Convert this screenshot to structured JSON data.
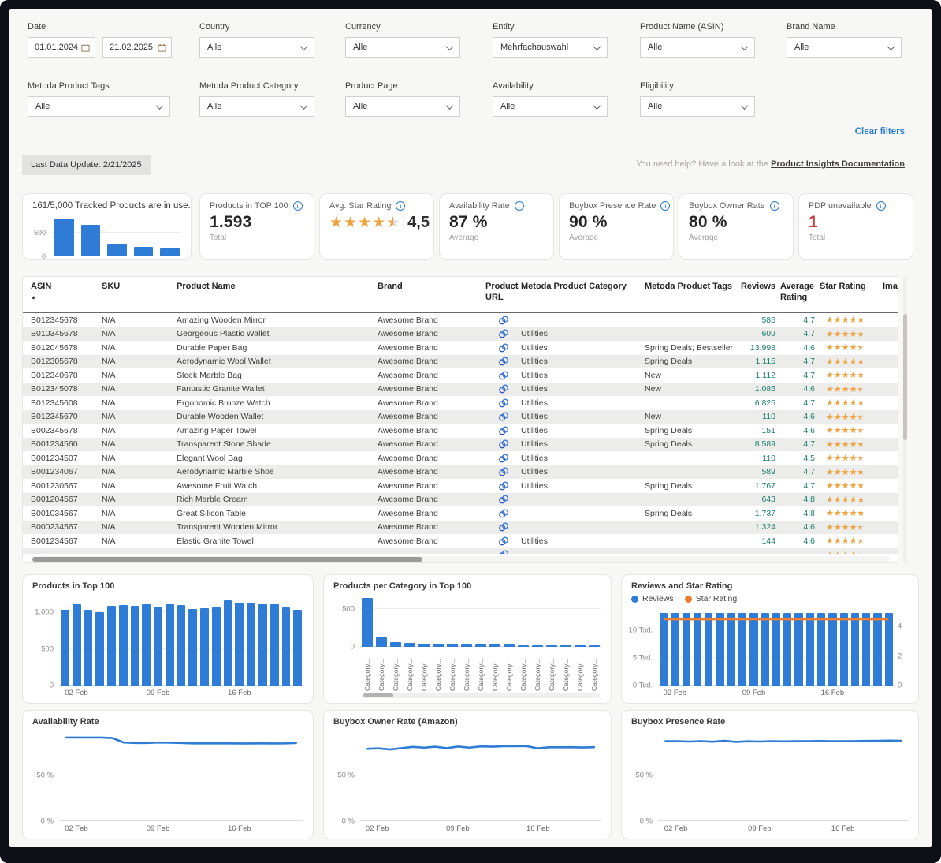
{
  "filters": {
    "date": {
      "label": "Date",
      "from": "01.01.2024",
      "to": "21.02.2025"
    },
    "row1": [
      {
        "label": "Country",
        "value": "Alle"
      },
      {
        "label": "Currency",
        "value": "Alle"
      },
      {
        "label": "Entity",
        "value": "Mehrfachauswahl"
      },
      {
        "label": "Product Name (ASIN)",
        "value": "Alle"
      },
      {
        "label": "Brand Name",
        "value": "Alle"
      }
    ],
    "row2": [
      {
        "label": "Metoda Product Tags",
        "value": "Alle"
      },
      {
        "label": "Metoda Product Category",
        "value": "Alle"
      },
      {
        "label": "Product Page",
        "value": "Alle"
      },
      {
        "label": "Availability",
        "value": "Alle"
      },
      {
        "label": "Eligibility",
        "value": "Alle"
      }
    ],
    "clear": "Clear filters"
  },
  "status": {
    "last_update": "Last Data Update: 2/21/2025",
    "help_text": "You need help? Have a look at the",
    "help_link": "Product Insights Documentation"
  },
  "kpis": {
    "top100": {
      "title": "Products in TOP 100",
      "value": "1.593",
      "sub": "Total"
    },
    "star": {
      "title": "Avg. Star Rating",
      "value": "4,5",
      "rating": 4.5
    },
    "availability": {
      "title": "Availability Rate",
      "value": "87 %",
      "sub": "Average"
    },
    "presence": {
      "title": "Buybox Presence Rate",
      "value": "90 %",
      "sub": "Average"
    },
    "owner": {
      "title": "Buybox Owner Rate",
      "value": "80 %",
      "sub": "Average"
    },
    "pdp": {
      "title": "PDP unavailable",
      "value": "1",
      "sub": "Total"
    }
  },
  "table": {
    "columns": [
      "ASIN",
      "SKU",
      "Product Name",
      "Brand",
      "Product URL",
      "Metoda Product Category",
      "Metoda Product Tags",
      "Reviews",
      "Average Rating",
      "Star Rating",
      "Ima"
    ],
    "rows": [
      {
        "asin": "B012345678",
        "sku": "N/A",
        "name": "Amazing Wooden Mirror",
        "brand": "Awesome Brand",
        "category": "",
        "tags": "",
        "reviews": "586",
        "rating": "4,7",
        "stars": 4.7
      },
      {
        "asin": "B010345678",
        "sku": "N/A",
        "name": "Georgeous Plastic Wallet",
        "brand": "Awesome Brand",
        "category": "Utilities",
        "tags": "",
        "reviews": "609",
        "rating": "4,7",
        "stars": 4.7
      },
      {
        "asin": "B012045678",
        "sku": "N/A",
        "name": "Durable Paper Bag",
        "brand": "Awesome Brand",
        "category": "Utilities",
        "tags": "Spring Deals; Bestseller",
        "reviews": "13.998",
        "rating": "4,6",
        "stars": 4.6
      },
      {
        "asin": "B012305678",
        "sku": "N/A",
        "name": "Aerodynamic Wool Wallet",
        "brand": "Awesome Brand",
        "category": "Utilities",
        "tags": "Spring Deals",
        "reviews": "1.115",
        "rating": "4,7",
        "stars": 4.7
      },
      {
        "asin": "B012340678",
        "sku": "N/A",
        "name": "Sleek Marble Bag",
        "brand": "Awesome Brand",
        "category": "Utilities",
        "tags": "New",
        "reviews": "1.112",
        "rating": "4,7",
        "stars": 4.7
      },
      {
        "asin": "B012345078",
        "sku": "N/A",
        "name": "Fantastic Granite Wallet",
        "brand": "Awesome Brand",
        "category": "Utilities",
        "tags": "New",
        "reviews": "1.085",
        "rating": "4,6",
        "stars": 4.6
      },
      {
        "asin": "B012345608",
        "sku": "N/A",
        "name": "Ergonomic Bronze Watch",
        "brand": "Awesome Brand",
        "category": "Utilities",
        "tags": "",
        "reviews": "6.825",
        "rating": "4,7",
        "stars": 4.7
      },
      {
        "asin": "B012345670",
        "sku": "N/A",
        "name": "Durable Wooden Wallet",
        "brand": "Awesome Brand",
        "category": "Utilities",
        "tags": "New",
        "reviews": "110",
        "rating": "4,6",
        "stars": 4.6
      },
      {
        "asin": "B002345678",
        "sku": "N/A",
        "name": "Amazing Paper Towel",
        "brand": "Awesome Brand",
        "category": "Utilities",
        "tags": "Spring Deals",
        "reviews": "151",
        "rating": "4,6",
        "stars": 4.6
      },
      {
        "asin": "B001234560",
        "sku": "N/A",
        "name": "Transparent Stone Shade",
        "brand": "Awesome Brand",
        "category": "Utilities",
        "tags": "Spring Deals",
        "reviews": "8.589",
        "rating": "4,7",
        "stars": 4.7
      },
      {
        "asin": "B001234507",
        "sku": "N/A",
        "name": "Elegant Wool Bag",
        "brand": "Awesome Brand",
        "category": "Utilities",
        "tags": "",
        "reviews": "110",
        "rating": "4,5",
        "stars": 4.5
      },
      {
        "asin": "B001234067",
        "sku": "N/A",
        "name": "Aerodynamic Marble Shoe",
        "brand": "Awesome Brand",
        "category": "Utilities",
        "tags": "",
        "reviews": "589",
        "rating": "4,7",
        "stars": 4.7
      },
      {
        "asin": "B001230567",
        "sku": "N/A",
        "name": "Awesome Fruit Watch",
        "brand": "Awesome Brand",
        "category": "Utilities",
        "tags": "Spring Deals",
        "reviews": "1.767",
        "rating": "4,7",
        "stars": 4.7
      },
      {
        "asin": "B001204567",
        "sku": "N/A",
        "name": "Rich Marble Cream",
        "brand": "Awesome Brand",
        "category": "",
        "tags": "",
        "reviews": "643",
        "rating": "4,8",
        "stars": 4.8
      },
      {
        "asin": "B001034567",
        "sku": "N/A",
        "name": "Great Silicon Table",
        "brand": "Awesome Brand",
        "category": "",
        "tags": "Spring Deals",
        "reviews": "1.737",
        "rating": "4,8",
        "stars": 4.8
      },
      {
        "asin": "B000234567",
        "sku": "N/A",
        "name": "Transparent Wooden Mirror",
        "brand": "Awesome Brand",
        "category": "",
        "tags": "",
        "reviews": "1.324",
        "rating": "4,6",
        "stars": 4.6
      },
      {
        "asin": "B001234567",
        "sku": "N/A",
        "name": "Elastic Granite Towel",
        "brand": "Awesome Brand",
        "category": "Utilities",
        "tags": "",
        "reviews": "144",
        "rating": "4,6",
        "stars": 4.6
      },
      {
        "asin": "",
        "sku": "",
        "name": "",
        "brand": "",
        "category": "",
        "tags": "",
        "reviews": "",
        "rating": "",
        "stars": 4.6
      }
    ]
  },
  "chart_data": [
    {
      "id": "tracked-mini",
      "type": "bar",
      "title": "161/5,000 Tracked Products are in use.",
      "values": [
        780,
        655,
        260,
        190,
        165
      ],
      "ylim": [
        0,
        820
      ],
      "yticks": [
        {
          "label": "500",
          "v": 500
        },
        {
          "label": "0",
          "v": 0
        }
      ]
    },
    {
      "id": "top100",
      "type": "bar",
      "title": "Products in Top 100",
      "values": [
        1040,
        1105,
        1040,
        1000,
        1085,
        1100,
        1090,
        1115,
        1070,
        1115,
        1095,
        1045,
        1055,
        1070,
        1160,
        1135,
        1135,
        1105,
        1105,
        1070,
        1040
      ],
      "ylim": [
        0,
        1250
      ],
      "yticks": [
        {
          "label": "1.000",
          "v": 1000
        },
        {
          "label": "500",
          "v": 500
        },
        {
          "label": "0",
          "v": 0
        }
      ],
      "xticks": [
        {
          "label": "02 Feb",
          "pos": 0.071
        },
        {
          "label": "09 Feb",
          "pos": 0.405
        },
        {
          "label": "16 Feb",
          "pos": 0.738
        }
      ]
    },
    {
      "id": "per-category",
      "type": "bar",
      "title": "Products per Category in Top 100",
      "values": [
        650,
        130,
        62,
        57,
        46,
        43,
        39,
        34,
        31,
        29,
        27,
        25,
        23,
        21,
        20,
        19,
        18
      ],
      "categories": [
        "Category...",
        "Category...",
        "Category...",
        "Category...",
        "Category...",
        "Category...",
        "Category...",
        "Category...",
        "Category...",
        "Category...",
        "Category...",
        "Category...",
        "Category...",
        "Category...",
        "Category...",
        "Category...",
        "Category..."
      ],
      "ylim": [
        0,
        700
      ],
      "yticks": [
        {
          "label": "500",
          "v": 500
        },
        {
          "label": "0",
          "v": 0
        }
      ]
    },
    {
      "id": "reviews-rating",
      "type": "combo",
      "title": "Reviews and Star Rating",
      "legend": [
        {
          "label": "Reviews",
          "color": "#2e7cd6"
        },
        {
          "label": "Star Rating",
          "color": "#ed7d31"
        }
      ],
      "bar_values": [
        13.1,
        13.12,
        13.15,
        13.1,
        13.18,
        13.12,
        13.1,
        13.2,
        13.12,
        13.15,
        13.1,
        13.12,
        13.2,
        13.12,
        13.1,
        13.15,
        13.2,
        13.12,
        13.1,
        13.15,
        13.12
      ],
      "line_values": [
        4.6,
        4.6,
        4.6,
        4.6,
        4.6,
        4.6,
        4.6,
        4.6,
        4.6,
        4.6,
        4.6,
        4.6,
        4.6,
        4.6,
        4.6,
        4.6,
        4.6,
        4.6,
        4.6,
        4.6,
        4.6
      ],
      "ylim_left": [
        0,
        14
      ],
      "ylim_right": [
        0,
        5.25
      ],
      "yticks_left": [
        {
          "label": "10 Tsd.",
          "v": 10
        },
        {
          "label": "5 Tsd.",
          "v": 5
        },
        {
          "label": "0 Tsd.",
          "v": 0
        }
      ],
      "yticks_right": [
        {
          "label": "4",
          "v": 4
        },
        {
          "label": "2",
          "v": 2
        },
        {
          "label": "0",
          "v": 0
        }
      ],
      "xticks": [
        {
          "label": "02 Feb",
          "pos": 0.071
        },
        {
          "label": "09 Feb",
          "pos": 0.405
        },
        {
          "label": "16 Feb",
          "pos": 0.738
        }
      ]
    },
    {
      "id": "availability-rate",
      "type": "line",
      "title": "Availability Rate",
      "values": [
        93,
        93,
        93,
        93,
        92.5,
        87.5,
        87,
        87,
        87.5,
        87.3,
        87,
        86.6,
        86.6,
        86.6,
        86.6,
        86.5,
        86.5,
        86.6,
        86.5,
        86.6,
        87
      ],
      "ylim": [
        0,
        100
      ],
      "yticks": [
        {
          "label": "50 %",
          "v": 50
        },
        {
          "label": "0 %",
          "v": 0
        }
      ],
      "xticks": [
        {
          "label": "02 Feb",
          "pos": 0.071
        },
        {
          "label": "09 Feb",
          "pos": 0.405
        },
        {
          "label": "16 Feb",
          "pos": 0.738
        }
      ]
    },
    {
      "id": "buybox-owner-rate",
      "type": "line",
      "title": "Buybox Owner Rate (Amazon)",
      "values": [
        80.5,
        81,
        79.8,
        81.2,
        82.6,
        81.8,
        82.8,
        81.2,
        83,
        81.8,
        83.2,
        82.8,
        83.4,
        83.4,
        83.6,
        81,
        82.2,
        82.2,
        82.3,
        82,
        82.3
      ],
      "ylim": [
        0,
        100
      ],
      "yticks": [
        {
          "label": "50 %",
          "v": 50
        },
        {
          "label": "0 %",
          "v": 0
        }
      ],
      "xticks": [
        {
          "label": "02 Feb",
          "pos": 0.071
        },
        {
          "label": "09 Feb",
          "pos": 0.405
        },
        {
          "label": "16 Feb",
          "pos": 0.738
        }
      ]
    },
    {
      "id": "buybox-presence-rate",
      "type": "line",
      "title": "Buybox Presence Rate",
      "values": [
        89,
        89,
        88.6,
        89,
        88.4,
        89.4,
        88.2,
        88.9,
        88.6,
        89,
        88.8,
        89,
        89,
        89.2,
        89,
        89,
        89.1,
        89.3,
        89.4,
        89.6,
        89.4
      ],
      "ylim": [
        0,
        100
      ],
      "yticks": [
        {
          "label": "50 %",
          "v": 50
        },
        {
          "label": "0 %",
          "v": 0
        }
      ],
      "xticks": [
        {
          "label": "02 Feb",
          "pos": 0.071
        },
        {
          "label": "09 Feb",
          "pos": 0.405
        },
        {
          "label": "16 Feb",
          "pos": 0.738
        }
      ]
    }
  ],
  "colors": {
    "accent": "#2e7cd6",
    "orange": "#ed7d31",
    "star": "#f0a23c",
    "teal": "#1b7f6d",
    "red": "#c43b3b",
    "link": "#2b7cd3"
  }
}
